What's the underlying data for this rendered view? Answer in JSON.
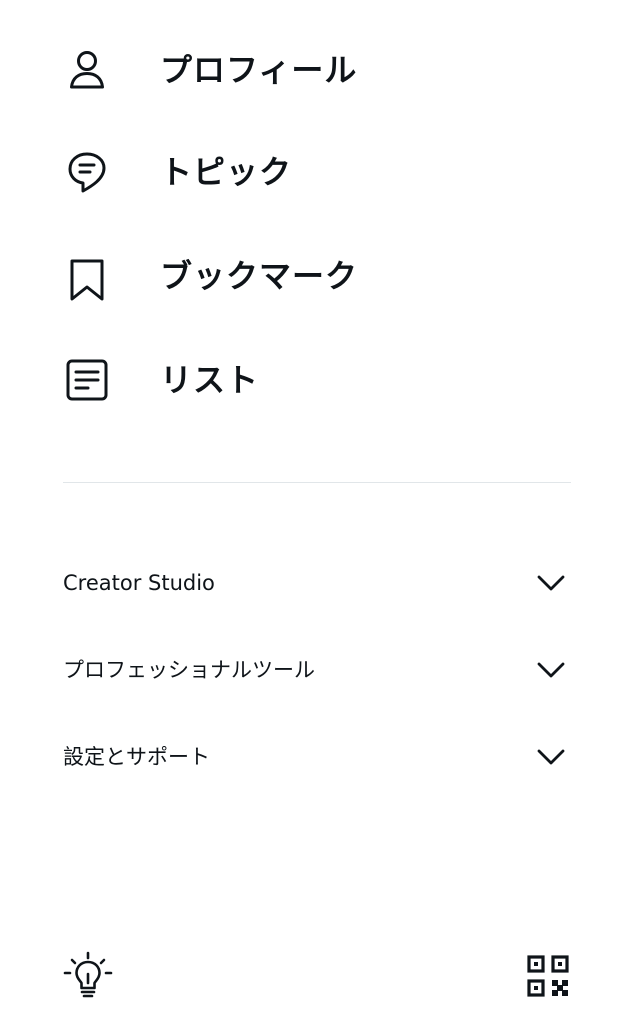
{
  "menu": {
    "items": [
      {
        "label": "プロフィール",
        "icon": "person-icon"
      },
      {
        "label": "トピック",
        "icon": "topic-speech-bubble-icon"
      },
      {
        "label": "ブックマーク",
        "icon": "bookmark-icon"
      },
      {
        "label": "リスト",
        "icon": "list-icon"
      }
    ]
  },
  "sections": [
    {
      "label": "Creator Studio",
      "icon": "chevron-down-icon"
    },
    {
      "label": "プロフェッショナルツール",
      "icon": "chevron-down-icon"
    },
    {
      "label": "設定とサポート",
      "icon": "chevron-down-icon"
    }
  ],
  "footer": {
    "left_icon": "lightbulb-icon",
    "right_icon": "qr-code-icon"
  },
  "colors": {
    "text": "#0f1419",
    "divider": "#e1e6e9",
    "background": "#ffffff"
  }
}
